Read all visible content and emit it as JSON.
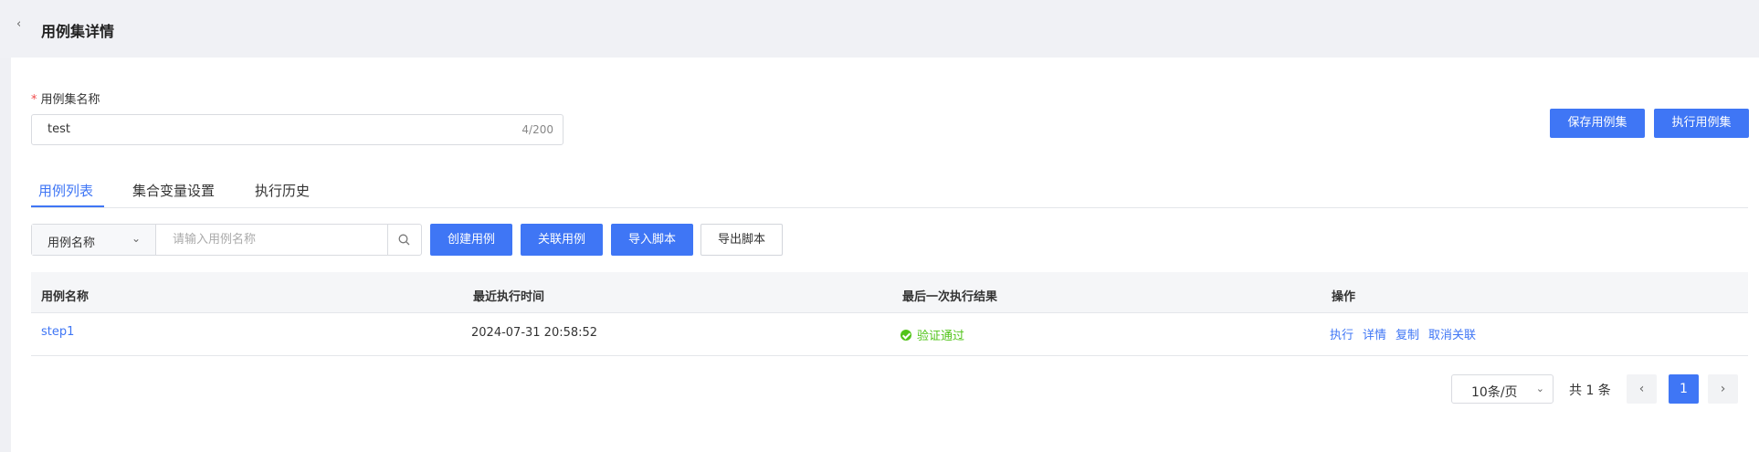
{
  "header": {
    "title": "用例集详情"
  },
  "form": {
    "name_label": "用例集名称",
    "required_mark": "*",
    "name_value": "test",
    "name_count": "4/200"
  },
  "actions": {
    "save": "保存用例集",
    "execute": "执行用例集"
  },
  "tabs": [
    {
      "label": "用例列表",
      "active": true
    },
    {
      "label": "集合变量设置",
      "active": false
    },
    {
      "label": "执行历史",
      "active": false
    }
  ],
  "toolbar": {
    "filter_select": "用例名称",
    "search_placeholder": "请输入用例名称",
    "create": "创建用例",
    "associate": "关联用例",
    "import": "导入脚本",
    "export": "导出脚本"
  },
  "table": {
    "columns": [
      "用例名称",
      "最近执行时间",
      "最后一次执行结果",
      "操作"
    ],
    "rows": [
      {
        "name": "step1",
        "last_run": "2024-07-31 20:58:52",
        "result": "验证通过",
        "ops": [
          "执行",
          "详情",
          "复制",
          "取消关联"
        ]
      }
    ]
  },
  "pagination": {
    "page_size": "10条/页",
    "total": "共 1 条",
    "current_page": "1",
    "prev": "‹",
    "next": "›"
  },
  "colors": {
    "primary": "#3f76f5",
    "success": "#52c41a",
    "required": "#f04a4a"
  }
}
